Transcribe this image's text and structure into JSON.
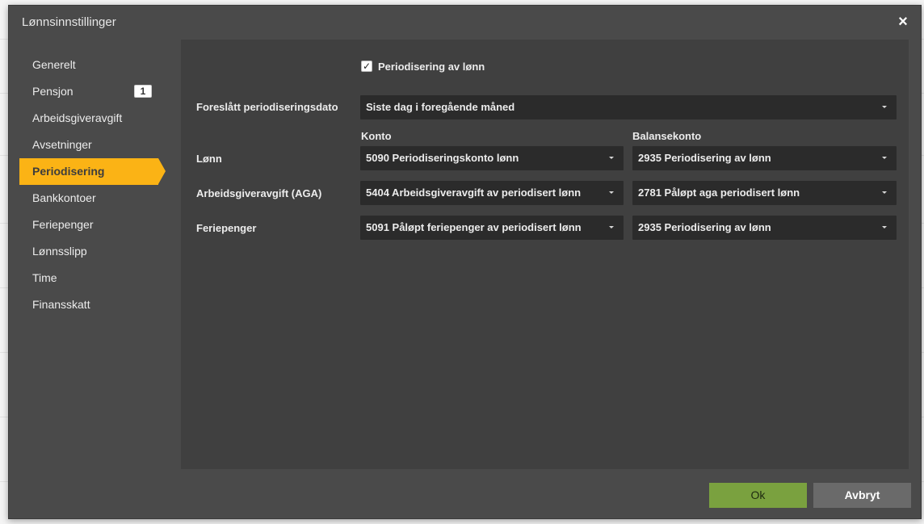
{
  "dialog": {
    "title": "Lønnsinnstillinger"
  },
  "sidebar": {
    "items": [
      {
        "label": "Generelt"
      },
      {
        "label": "Pensjon",
        "badge": "1"
      },
      {
        "label": "Arbeidsgiveravgift"
      },
      {
        "label": "Avsetninger"
      },
      {
        "label": "Periodisering",
        "active": true
      },
      {
        "label": "Bankkontoer"
      },
      {
        "label": "Feriepenger"
      },
      {
        "label": "Lønnsslipp"
      },
      {
        "label": "Time"
      },
      {
        "label": "Finansskatt"
      }
    ]
  },
  "form": {
    "checkbox": {
      "label": "Periodisering av lønn",
      "checked": true
    },
    "date_label": "Foreslått periodiseringsdato",
    "date_value": "Siste dag i foregående måned",
    "col_konto": "Konto",
    "col_balanse": "Balansekonto",
    "rows": [
      {
        "label": "Lønn",
        "konto": "5090 Periodiseringskonto lønn",
        "balanse": "2935 Periodisering av lønn"
      },
      {
        "label": "Arbeidsgiveravgift (AGA)",
        "konto": "5404 Arbeidsgiveravgift av periodisert lønn",
        "balanse": "2781 Påløpt aga periodisert lønn"
      },
      {
        "label": "Feriepenger",
        "konto": "5091 Påløpt feriepenger av periodisert lønn",
        "balanse": "2935 Periodisering av lønn"
      }
    ]
  },
  "buttons": {
    "ok": "Ok",
    "cancel": "Avbryt"
  },
  "icons": {
    "close": "close-icon",
    "check": "check-icon",
    "caret": "chevron-down-icon"
  },
  "colors": {
    "accent": "#fbb315",
    "ok": "#7aa13f",
    "dialog_bg": "#4a4a4a",
    "panel_bg": "#404040",
    "select_bg": "#2b2b2b"
  }
}
